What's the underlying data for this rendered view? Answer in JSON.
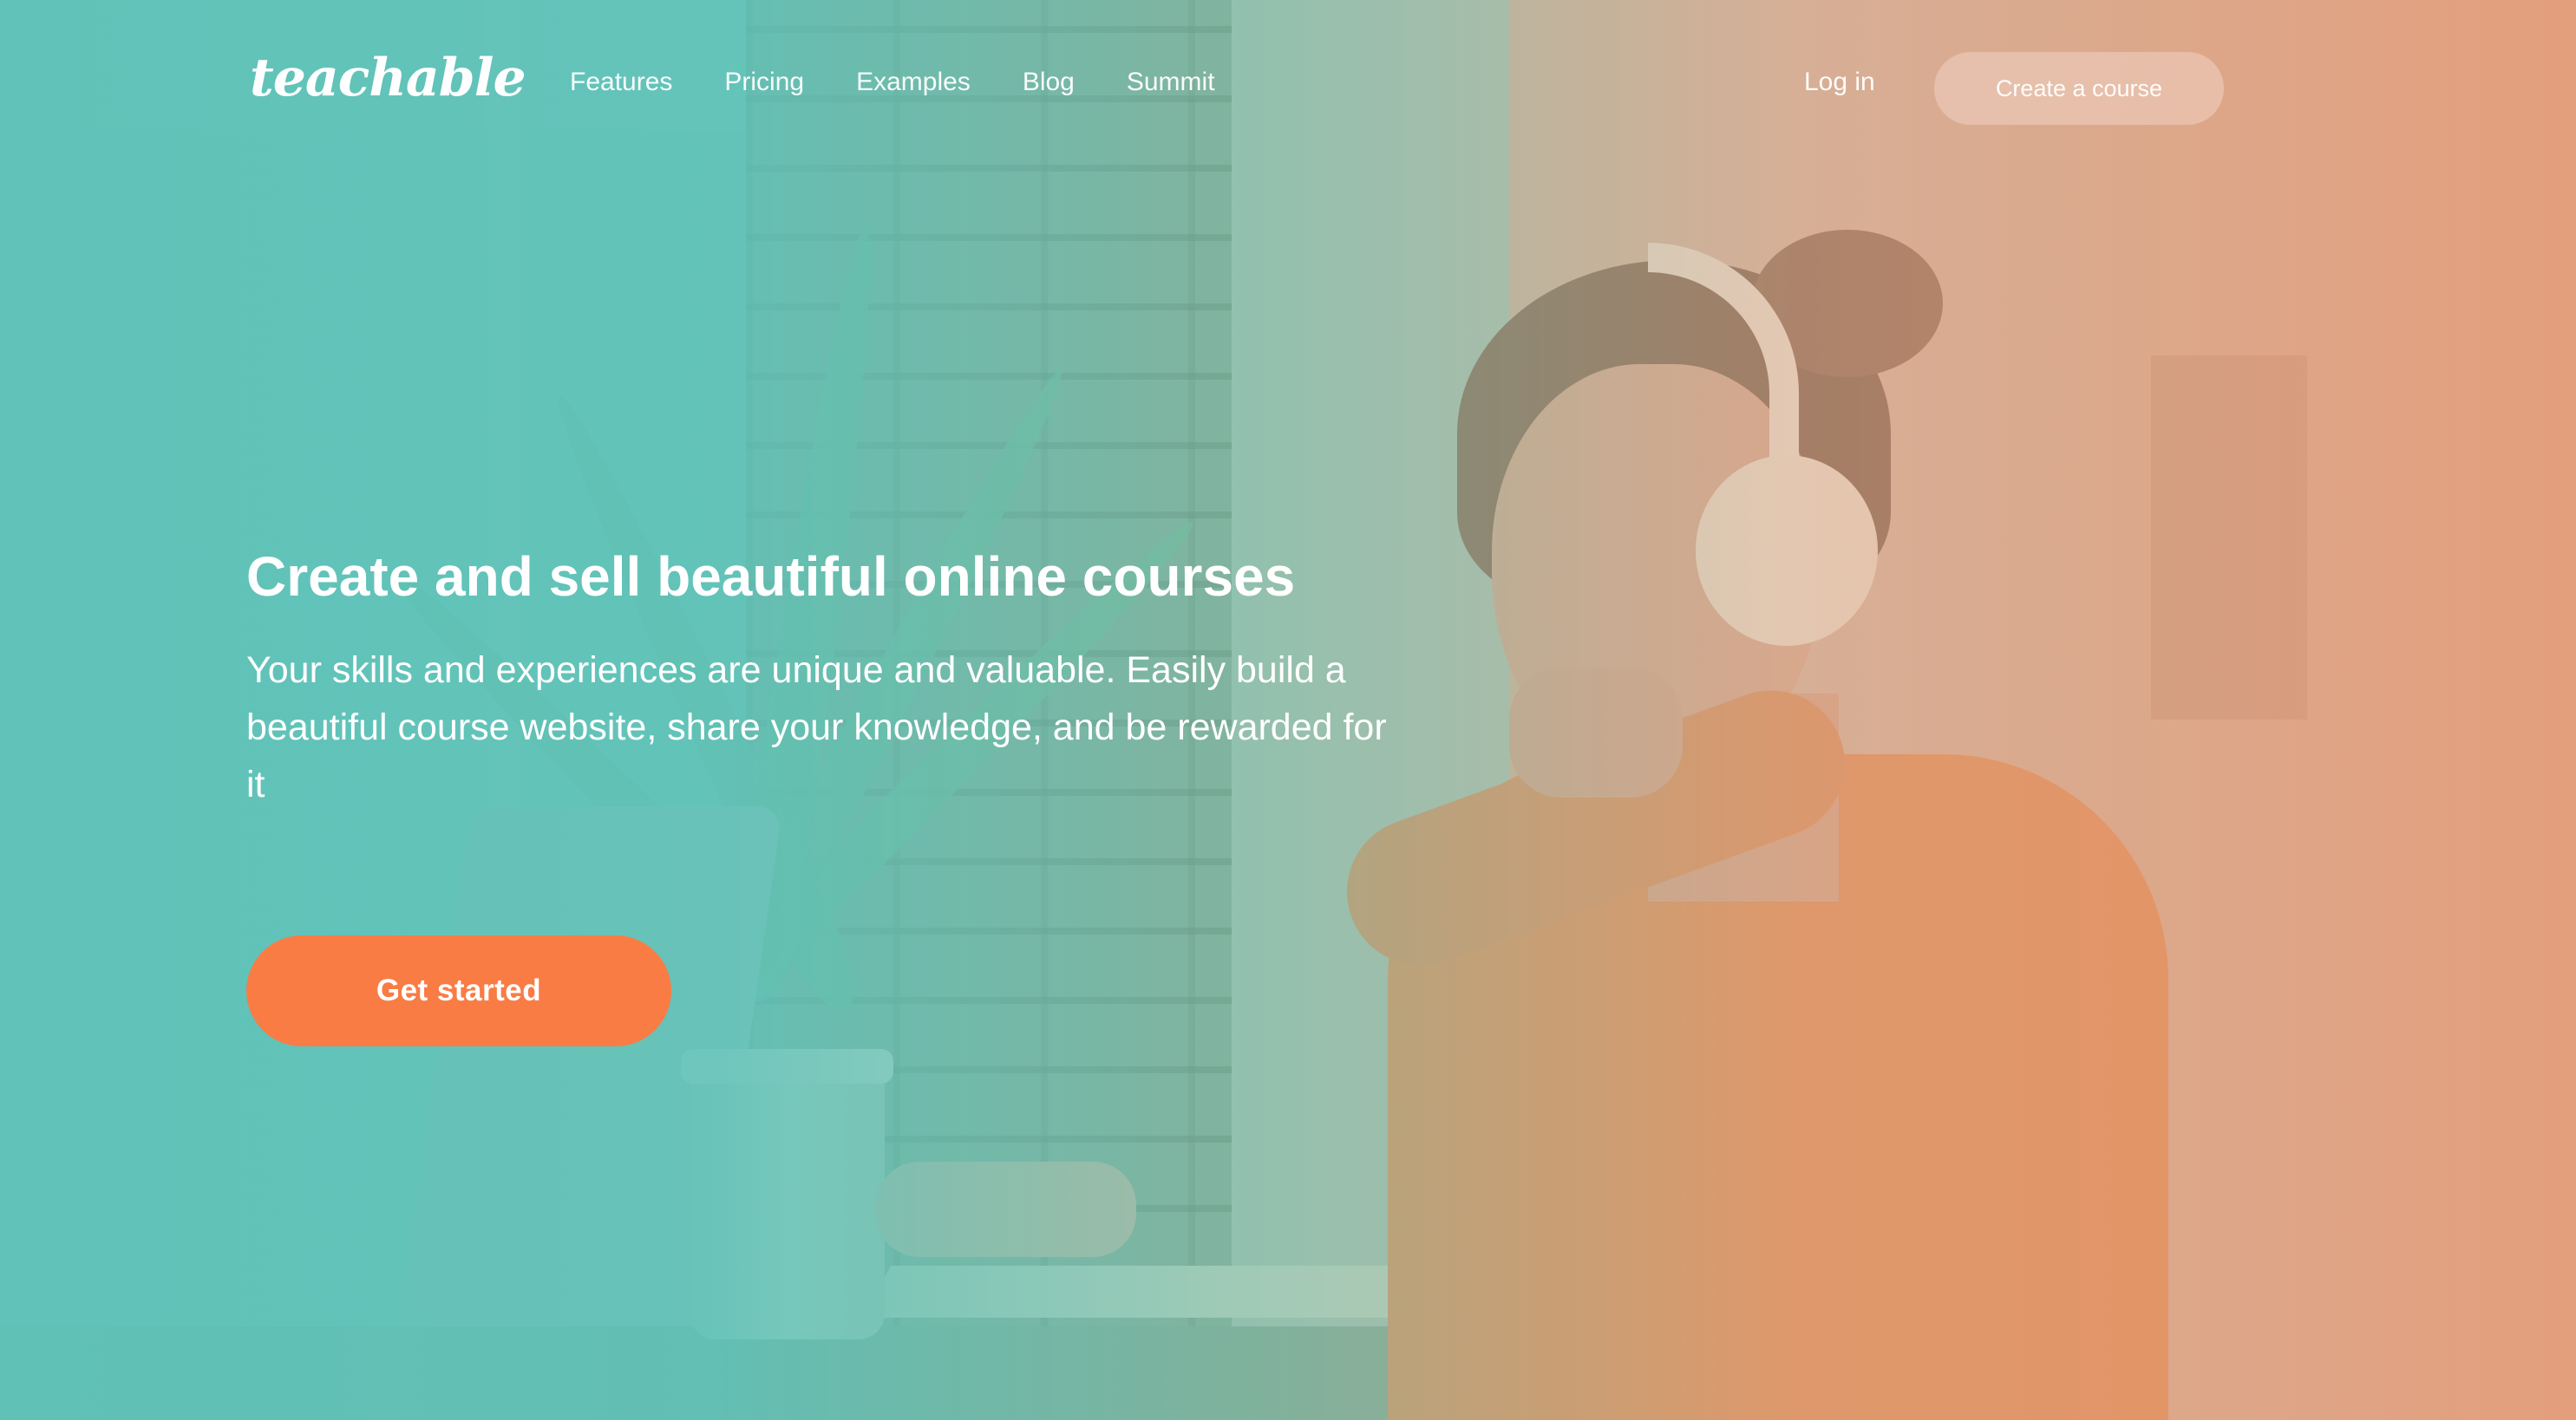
{
  "nav": {
    "logo": "teachable",
    "links": [
      "Features",
      "Pricing",
      "Examples",
      "Blog",
      "Summit"
    ],
    "login": "Log in",
    "cta": "Create a course"
  },
  "hero": {
    "title": "Create and sell beautiful online courses",
    "subtitle": "Your skills and experiences are unique and valuable. Easily build a beautiful course website, share your knowledge, and be rewarded for it",
    "button": "Get started"
  },
  "colors": {
    "teal": "#5fc2b8",
    "peach": "#e9966e",
    "accent": "#f97c45",
    "text": "#ffffff"
  }
}
